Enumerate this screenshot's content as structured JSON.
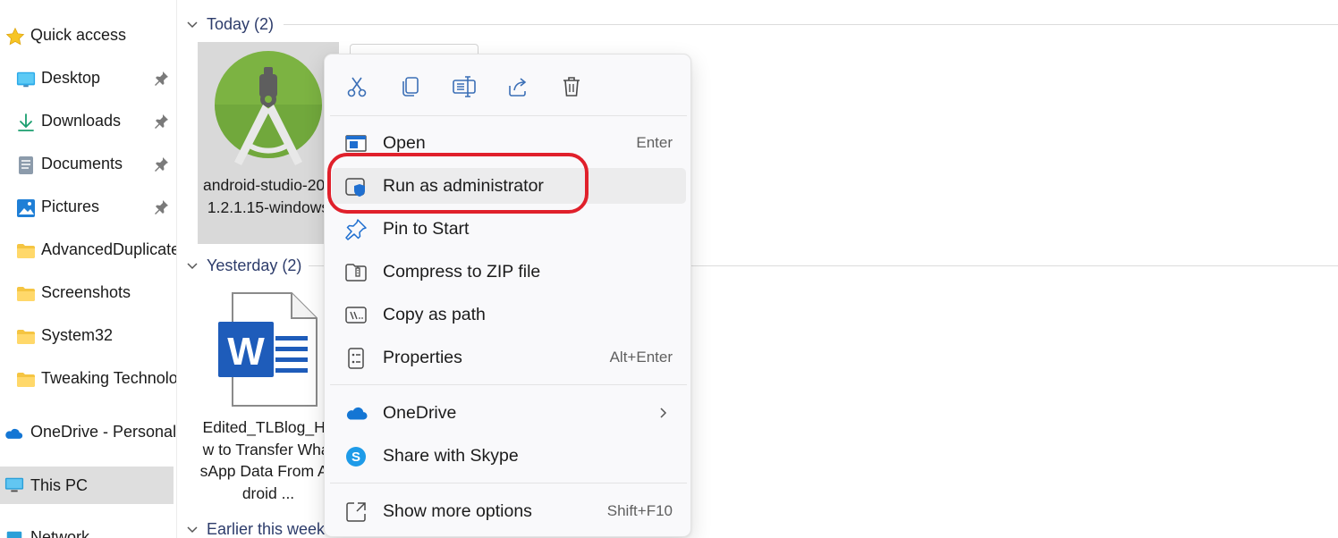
{
  "sidebar": {
    "quick_access": "Quick access",
    "items": [
      {
        "label": "Desktop",
        "pinned": true
      },
      {
        "label": "Downloads",
        "pinned": true
      },
      {
        "label": "Documents",
        "pinned": true
      },
      {
        "label": "Pictures",
        "pinned": true
      },
      {
        "label": "AdvancedDuplicate",
        "pinned": false
      },
      {
        "label": "Screenshots",
        "pinned": false
      },
      {
        "label": "System32",
        "pinned": false
      },
      {
        "label": "Tweaking Technolo",
        "pinned": false
      }
    ],
    "onedrive": "OneDrive - Personal",
    "this_pc": "This PC",
    "network": "Network"
  },
  "groups": {
    "today": "Today (2)",
    "yesterday": "Yesterday (2)",
    "earlier": "Earlier this week"
  },
  "files": {
    "android_studio": {
      "name": "android-studio-2021.2.1.15-windows",
      "icon": "android-studio-icon"
    },
    "word_doc": {
      "name": "Edited_TLBlog_How to Transfer WhatsApp Data From Android ...",
      "icon": "word-document-icon"
    }
  },
  "context_menu": {
    "toolbar": [
      {
        "name": "cut",
        "icon": "scissors-icon"
      },
      {
        "name": "copy",
        "icon": "copy-icon"
      },
      {
        "name": "rename",
        "icon": "rename-icon"
      },
      {
        "name": "share",
        "icon": "share-icon"
      },
      {
        "name": "delete",
        "icon": "trash-icon"
      }
    ],
    "items": {
      "open": {
        "label": "Open",
        "shortcut": "Enter"
      },
      "run_admin": {
        "label": "Run as administrator"
      },
      "pin_start": {
        "label": "Pin to Start"
      },
      "compress": {
        "label": "Compress to ZIP file"
      },
      "copy_path": {
        "label": "Copy as path"
      },
      "properties": {
        "label": "Properties",
        "shortcut": "Alt+Enter"
      },
      "onedrive": {
        "label": "OneDrive"
      },
      "skype": {
        "label": "Share with Skype"
      },
      "more": {
        "label": "Show more options",
        "shortcut": "Shift+F10"
      }
    },
    "highlighted_item": "Run as administrator",
    "highlight_color": "#e0202b"
  },
  "colors": {
    "accent": "#0067c0",
    "folder": "#f5c542",
    "android_green": "#7cb342",
    "word_blue": "#1e5cba"
  }
}
